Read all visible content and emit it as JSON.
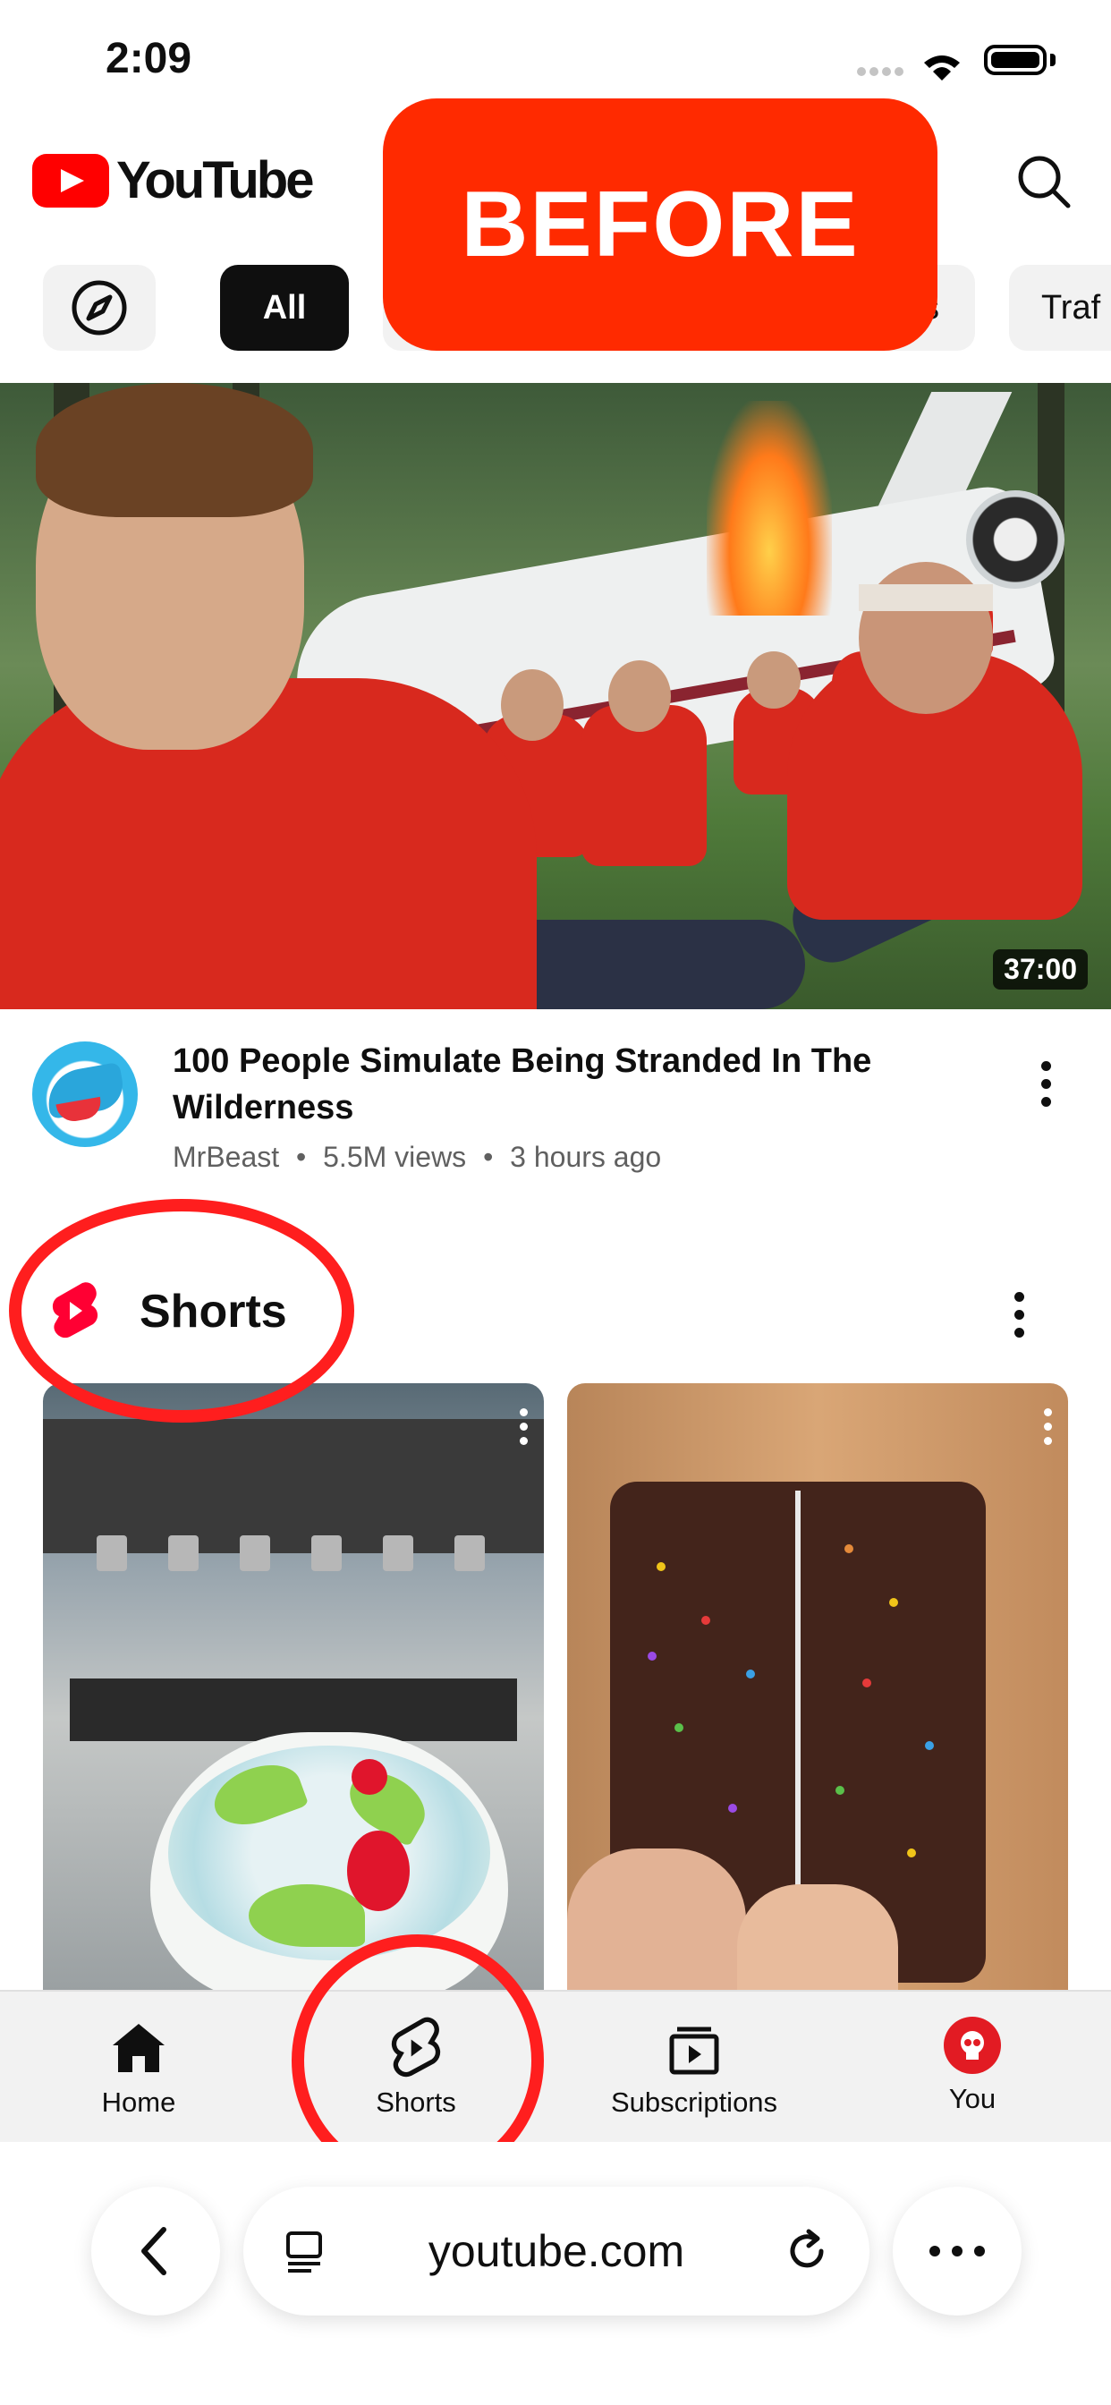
{
  "status_bar": {
    "time": "2:09"
  },
  "header": {
    "app_name": "YouTube",
    "overlay_label": "BEFORE",
    "icons": [
      "youtube-logo-icon",
      "search-icon"
    ]
  },
  "chips": [
    {
      "label": "",
      "icon": "compass-icon"
    },
    {
      "label": "All",
      "selected": true
    },
    {
      "label": "s"
    },
    {
      "label": "Traf"
    }
  ],
  "feed": {
    "video": {
      "title": "100 People Simulate Being Stranded In The Wilderness",
      "channel": "MrBeast",
      "views": "5.5M views",
      "age": "3 hours ago",
      "separator": "•",
      "duration": "37:00"
    },
    "shorts_section": {
      "title": "Shorts"
    }
  },
  "bottom_nav": [
    {
      "label": "Home",
      "icon": "home-icon"
    },
    {
      "label": "Shorts",
      "icon": "shorts-icon"
    },
    {
      "label": "Subscriptions",
      "icon": "subscriptions-icon"
    },
    {
      "label": "You",
      "icon": "avatar-icon"
    }
  ],
  "browser": {
    "url": "youtube.com"
  },
  "colors": {
    "youtube_red": "#ff0000",
    "annotation_red": "#ff1e1e",
    "overlay_red": "#ff2a00",
    "chip_selected": "#0f0f0f"
  }
}
